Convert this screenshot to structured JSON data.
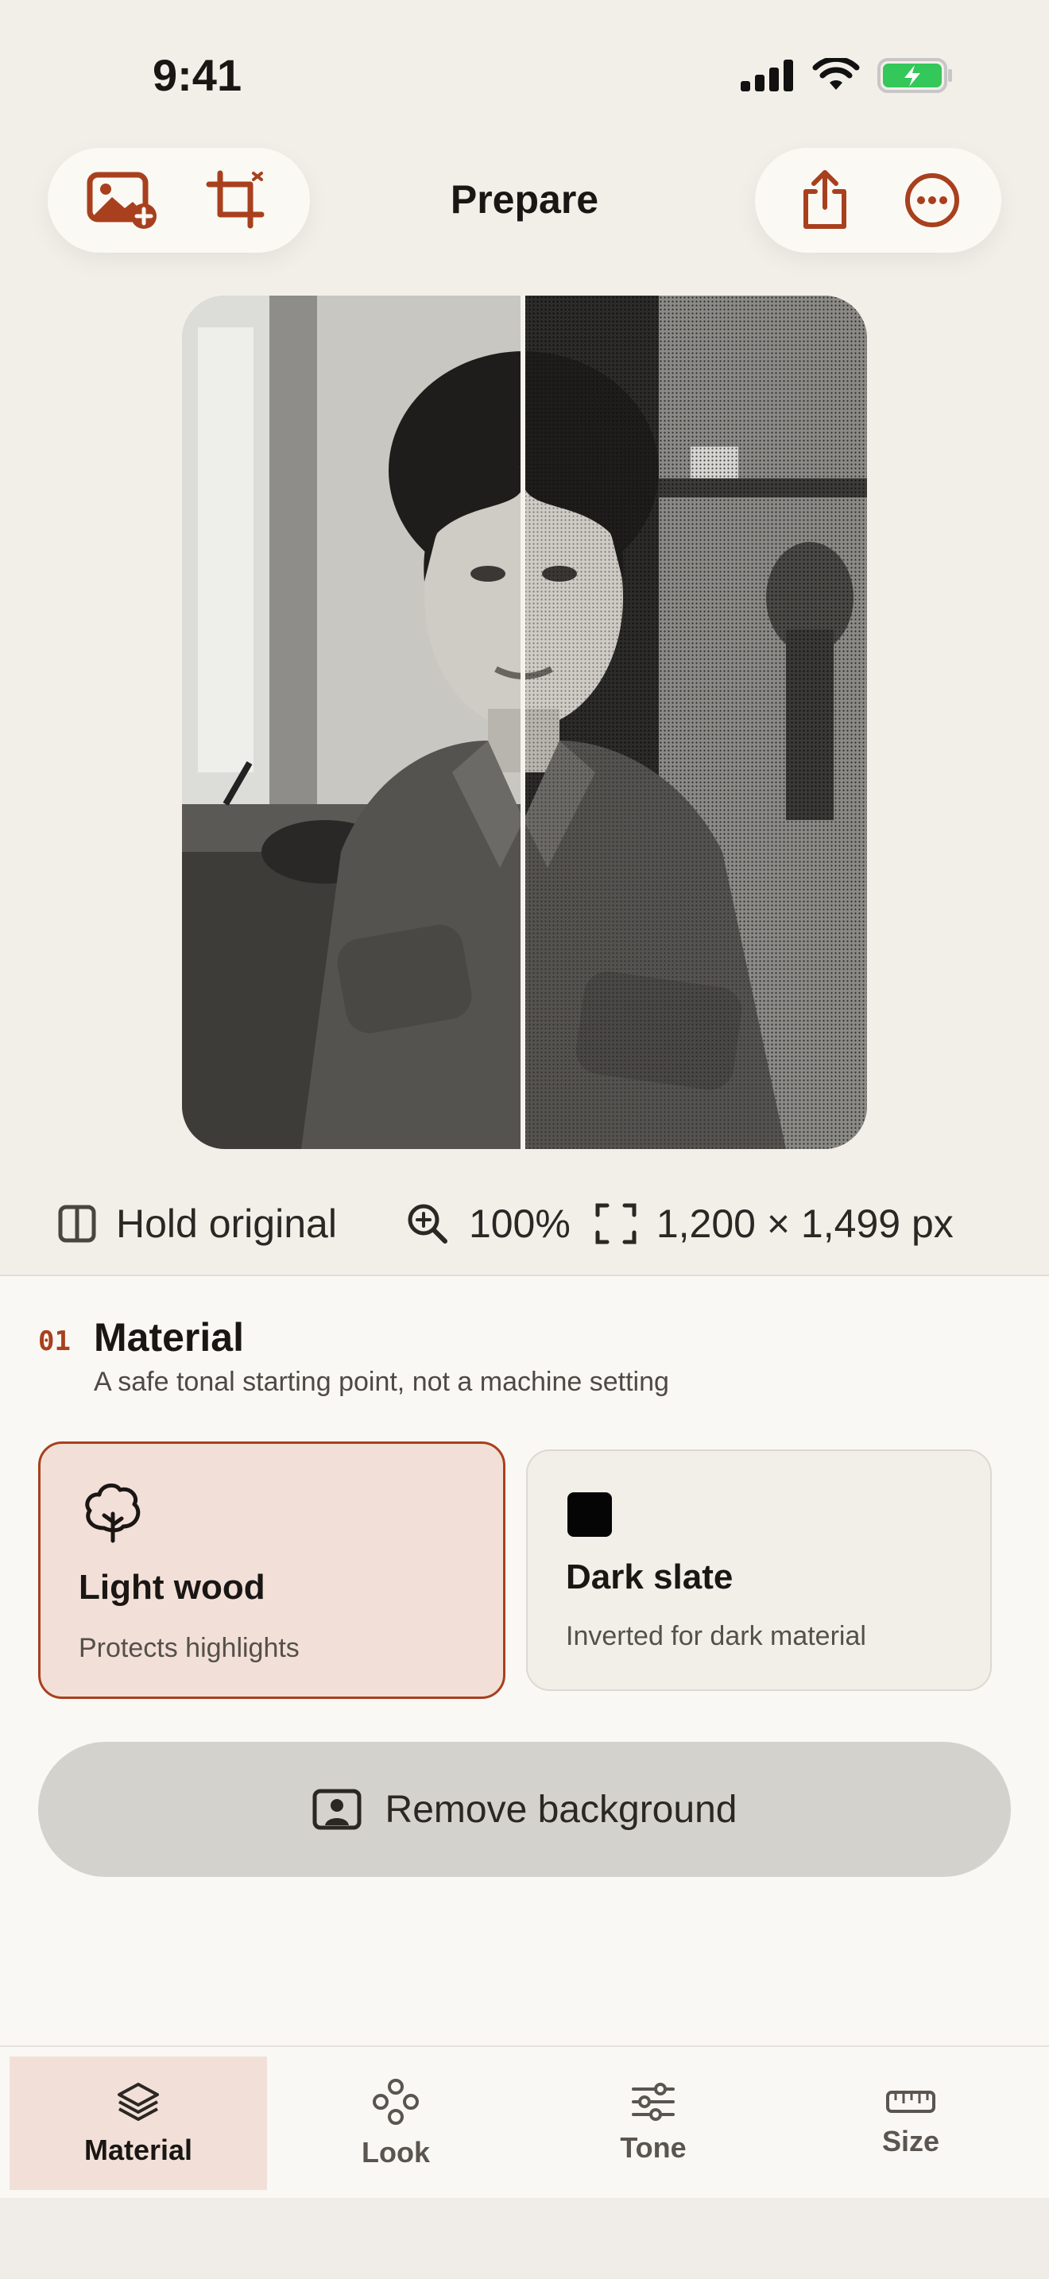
{
  "status_bar": {
    "time": "9:41"
  },
  "toolbar": {
    "title": "Prepare",
    "add_photo_icon": "photo-add-icon",
    "crop_icon": "crop-icon",
    "share_icon": "share-icon",
    "more_icon": "more-icon"
  },
  "preview": {
    "hold_label": "Hold original",
    "zoom_value": "100%",
    "dimensions": "1,200 × 1,499 px"
  },
  "section": {
    "number": "01",
    "title": "Material",
    "subtitle": "A safe tonal starting point, not a machine setting"
  },
  "materials": [
    {
      "title": "Light wood",
      "subtitle": "Protects highlights",
      "icon": "tree-icon",
      "selected": true
    },
    {
      "title": "Dark slate",
      "subtitle": "Inverted for dark material",
      "icon": "black-square-icon",
      "selected": false
    }
  ],
  "remove_background": {
    "label": "Remove background",
    "icon": "portrait-icon"
  },
  "tabs": [
    {
      "label": "Material",
      "icon": "layers-icon",
      "active": true
    },
    {
      "label": "Look",
      "icon": "nodes-icon",
      "active": false
    },
    {
      "label": "Tone",
      "icon": "sliders-icon",
      "active": false
    },
    {
      "label": "Size",
      "icon": "ruler-icon",
      "active": false
    }
  ],
  "colors": {
    "accent": "#a8401e",
    "selected_bg": "#f2e0d8",
    "background": "#f2efe9",
    "battery": "#34c759"
  }
}
